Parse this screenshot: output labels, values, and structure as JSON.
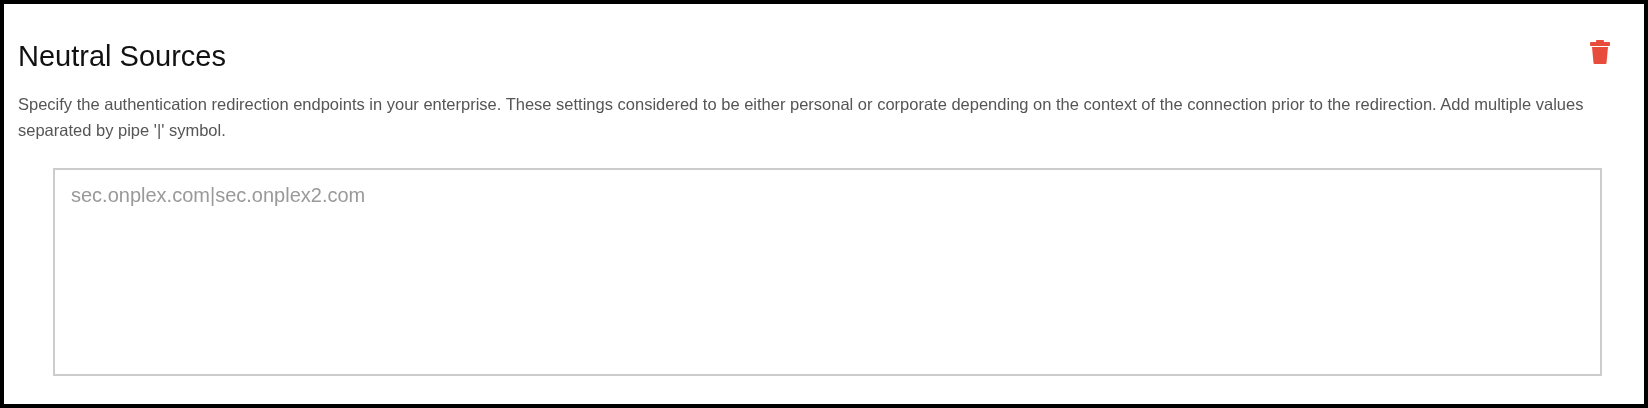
{
  "section": {
    "title": "Neutral Sources",
    "description": "Specify the authentication redirection endpoints in your enterprise. These settings considered to be either personal or corporate depending on the context of the connection prior to the redirection. Add multiple values separated by pipe '|' symbol.",
    "field": {
      "placeholder": "sec.onplex.com|sec.onplex2.com"
    }
  }
}
